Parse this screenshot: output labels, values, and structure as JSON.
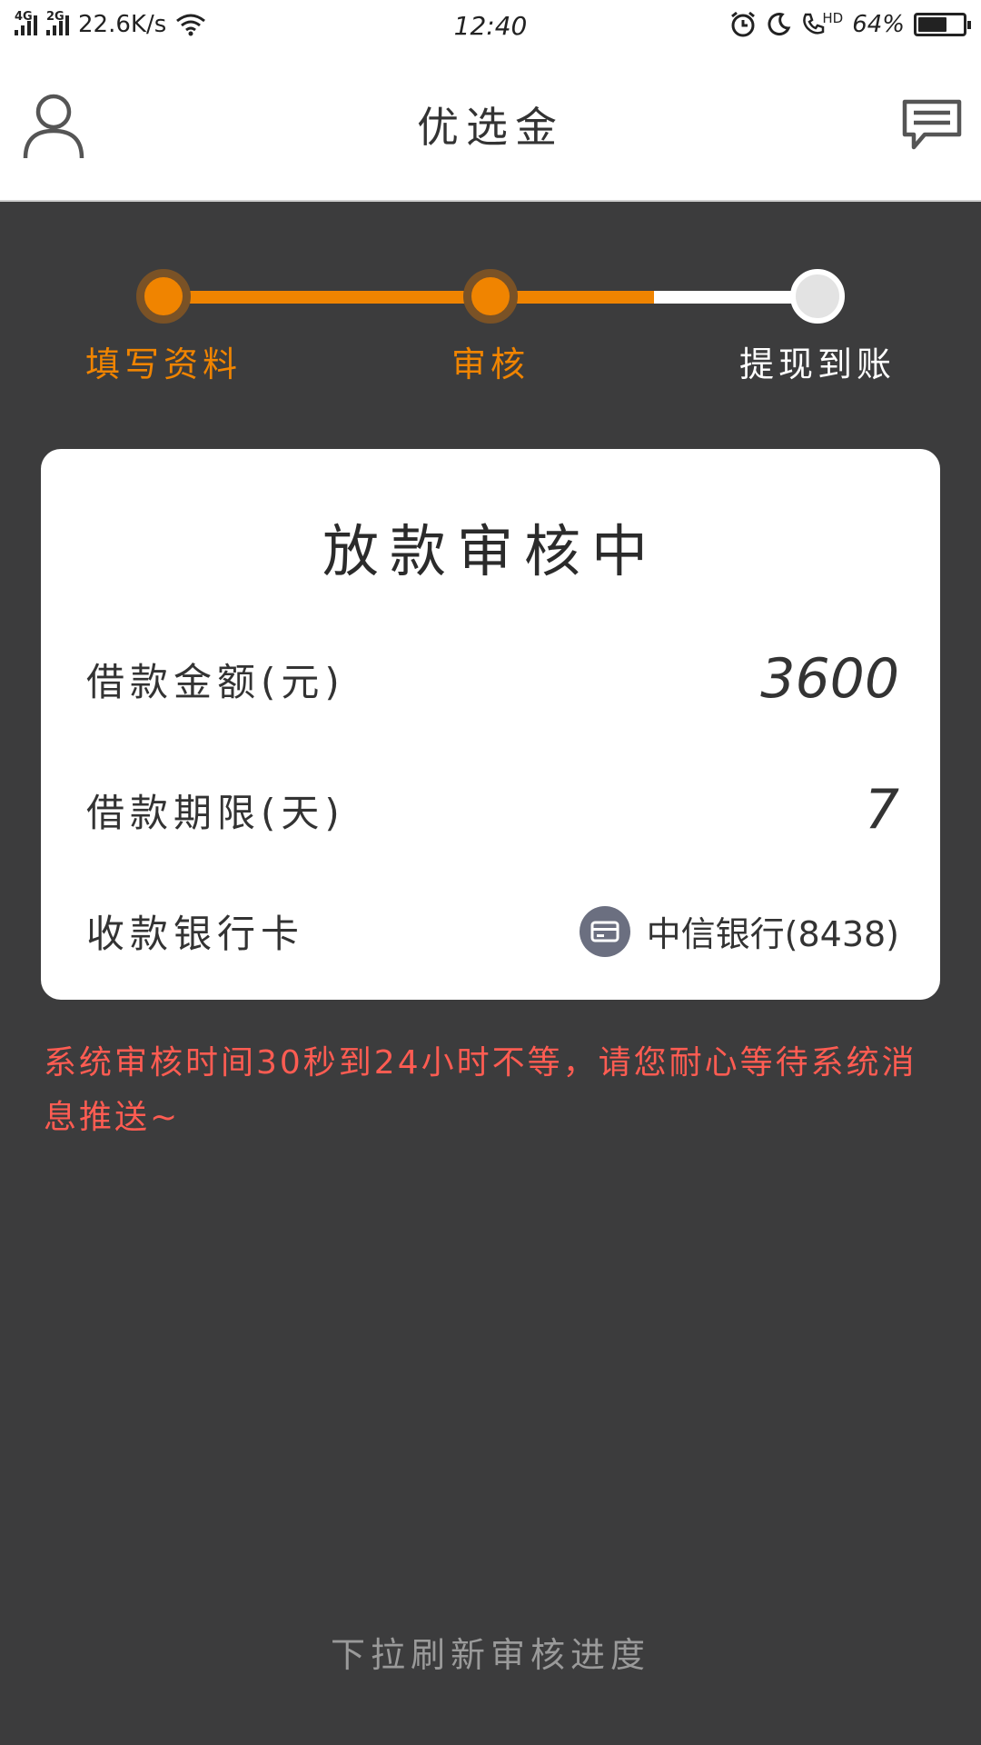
{
  "status_bar": {
    "network1": "4G",
    "network2": "2G",
    "speed": "22.6K/s",
    "time": "12:40",
    "hd": "HD",
    "battery": "64%",
    "battery_level": 0.64
  },
  "header": {
    "title": "优选金"
  },
  "steps": [
    {
      "label": "填写资料",
      "state": "done"
    },
    {
      "label": "审核",
      "state": "current"
    },
    {
      "label": "提现到账",
      "state": "pending"
    }
  ],
  "colors": {
    "accent": "#f08400",
    "background": "#3c3c3d",
    "notice": "#ff5c52"
  },
  "card": {
    "title": "放款审核中",
    "amount_label": "借款金额(元)",
    "amount_value": "3600",
    "term_label": "借款期限(天)",
    "term_value": "7",
    "bank_label": "收款银行卡",
    "bank_value": "中信银行(8438)"
  },
  "notice": "系统审核时间30秒到24小时不等，请您耐心等待系统消息推送~",
  "pull_hint": "下拉刷新审核进度"
}
